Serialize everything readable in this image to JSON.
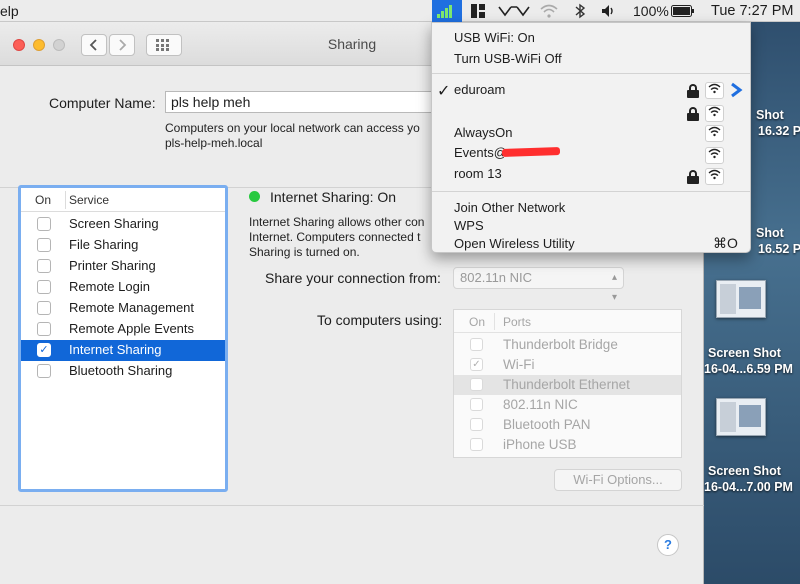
{
  "menubar": {
    "app_menu": "elp",
    "battery": "100%",
    "clock": "Tue 7:27 PM"
  },
  "desktop": {
    "items": [
      {
        "label1": "Shot",
        "label2": "16.32 PM"
      },
      {
        "label1": "Shot",
        "label2": "16.52 PM"
      },
      {
        "label1": "Screen Shot",
        "label2": "16-04...6.59 PM"
      },
      {
        "label1": "Screen Shot",
        "label2": "16-04...7.00 PM"
      }
    ]
  },
  "window": {
    "title": "Sharing",
    "computer_name_label": "Computer Name:",
    "computer_name_value": "pls help meh",
    "local_note_line1": "Computers on your local network can access yo",
    "local_note_line2": "pls-help-meh.local",
    "service_header": {
      "on": "On",
      "service": "Service"
    },
    "services": [
      {
        "label": "Screen Sharing",
        "checked": false
      },
      {
        "label": "File Sharing",
        "checked": false
      },
      {
        "label": "Printer Sharing",
        "checked": false
      },
      {
        "label": "Remote Login",
        "checked": false
      },
      {
        "label": "Remote Management",
        "checked": false
      },
      {
        "label": "Remote Apple Events",
        "checked": false
      },
      {
        "label": "Internet Sharing",
        "checked": true,
        "selected": true
      },
      {
        "label": "Bluetooth Sharing",
        "checked": false
      }
    ],
    "status_title": "Internet Sharing: On",
    "status_desc_line1": "Internet Sharing allows other con",
    "status_desc_line2": "Internet. Computers connected t",
    "status_desc_line3": "Sharing is turned on.",
    "share_from_label": "Share your connection from:",
    "share_from_value": "802.11n NIC",
    "to_computers_label": "To computers using:",
    "ports_header": {
      "on": "On",
      "ports": "Ports"
    },
    "ports": [
      {
        "label": "Thunderbolt Bridge",
        "checked": false
      },
      {
        "label": "Wi-Fi",
        "checked": true
      },
      {
        "label": "Thunderbolt Ethernet",
        "checked": false,
        "highlighted": true
      },
      {
        "label": "802.11n NIC",
        "checked": false
      },
      {
        "label": "Bluetooth PAN",
        "checked": false
      },
      {
        "label": "iPhone USB",
        "checked": false
      }
    ],
    "wifi_options_button": "Wi-Fi Options...",
    "help_button": "?"
  },
  "wifi_menu": {
    "status": "USB WiFi: On",
    "toggle": "Turn USB-WiFi Off",
    "connected_check": "✓",
    "networks": [
      {
        "name": "eduroam",
        "locked": true,
        "connected": true
      },
      {
        "name": "",
        "locked": true,
        "connected": false
      },
      {
        "name": "AlwaysOn",
        "locked": false,
        "connected": false
      },
      {
        "name": "Events@",
        "locked": false,
        "connected": false
      },
      {
        "name": "room 13",
        "locked": true,
        "connected": false
      }
    ],
    "join_other": "Join Other Network",
    "wps": "WPS",
    "open_utility": "Open Wireless Utility",
    "open_utility_shortcut": "⌘O"
  },
  "colors": {
    "selection": "#1167d8",
    "status_dot": "#27c93f",
    "wifi_active_bg": "#1f6fe0",
    "redaction": "#ff2e2e"
  }
}
